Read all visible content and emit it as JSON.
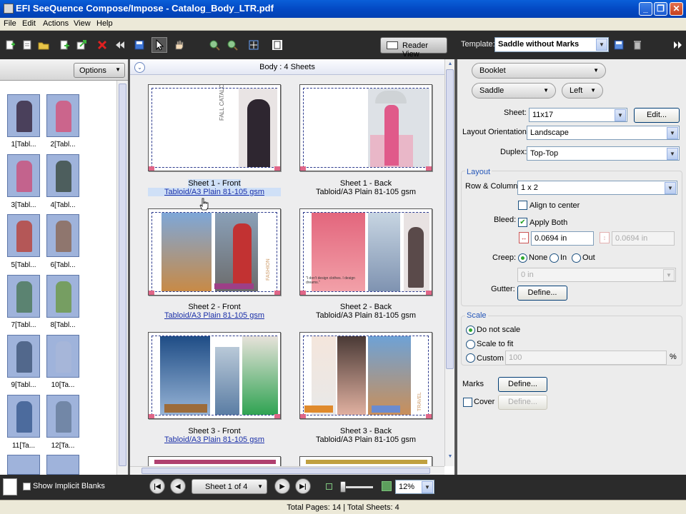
{
  "window": {
    "title": "EFI SeeQuence Compose/Impose - Catalog_Body_LTR.pdf",
    "minimize": "_",
    "maximize": "❐",
    "close": "✕"
  },
  "menu": [
    "File",
    "Edit",
    "Actions",
    "View",
    "Help"
  ],
  "toolbar": {
    "icons": [
      "new-icon",
      "open-icon",
      "folder-icon",
      "add-page-icon",
      "export-icon",
      "delete-icon",
      "rewind-icon",
      "save-icon",
      "pointer-icon",
      "hand-icon",
      "zoom-in-icon",
      "zoom-out-icon",
      "fit-icon",
      "document-icon"
    ],
    "reader_view": "Reader View",
    "template_label": "Template:",
    "template_value": "Saddle without Marks"
  },
  "left_panel": {
    "options_label": "Options",
    "thumbnails": [
      "1[Tabl...",
      "2[Tabl...",
      "3[Tabl...",
      "4[Tabl...",
      "5[Tabl...",
      "6[Tabl...",
      "7[Tabl...",
      "8[Tabl...",
      "9[Tabl...",
      "10[Ta...",
      "11[Ta...",
      "12[Ta..."
    ]
  },
  "center": {
    "header": "Body : 4 Sheets",
    "collapse_glyph": "⌄",
    "sheets": [
      {
        "line1": "Sheet 1 - Front",
        "line2": "Tabloid/A3 Plain 81-105 gsm",
        "vert_text": "FALL CATALOG"
      },
      {
        "line1": "Sheet 1 - Back",
        "line2": "Tabloid/A3 Plain 81-105 gsm"
      },
      {
        "line1": "Sheet 2 - Front",
        "line2": "Tabloid/A3 Plain 81-105 gsm",
        "vert_text": "FASHION"
      },
      {
        "line1": "Sheet 2 - Back",
        "line2": "Tabloid/A3 Plain 81-105 gsm",
        "caption": "\"I don't design clothes. I design dreams.\""
      },
      {
        "line1": "Sheet 3 - Front",
        "line2": "Tabloid/A3 Plain 81-105 gsm"
      },
      {
        "line1": "Sheet 3 - Back",
        "line2": "Tabloid/A3 Plain 81-105 gsm",
        "vert_text": "TRAVEL"
      }
    ]
  },
  "right_panel": {
    "booklet": "Booklet",
    "saddle": "Saddle",
    "left": "Left",
    "sheet_label": "Sheet:",
    "sheet_value": "11x17",
    "edit_btn": "Edit...",
    "orientation_label": "Layout Orientation:",
    "orientation_value": "Landscape",
    "duplex_label": "Duplex:",
    "duplex_value": "Top-Top",
    "layout_title": "Layout",
    "row_col_label": "Row & Column:",
    "row_col_value": "1 x 2",
    "align_center": "Align to center",
    "bleed_label": "Bleed:",
    "apply_both": "Apply Both",
    "bleed_h": "0.0694 in",
    "bleed_v": "0.0694 in",
    "creep_label": "Creep:",
    "creep_none": "None",
    "creep_in": "In",
    "creep_out": "Out",
    "creep_value": "0 in",
    "gutter_label": "Gutter:",
    "gutter_btn": "Define...",
    "scale_title": "Scale",
    "scale_none": "Do not scale",
    "scale_fit": "Scale to fit",
    "scale_custom": "Custom",
    "custom_value": "100",
    "percent": "%",
    "marks_label": "Marks",
    "marks_btn": "Define...",
    "cover_label": "Cover",
    "cover_btn": "Define..."
  },
  "bottom": {
    "show_blanks": "Show Implicit Blanks",
    "sheet_nav": "Sheet 1 of 4",
    "zoom": "12%",
    "nav_first": "|◀",
    "nav_prev": "◀",
    "nav_next": "▶",
    "nav_last": "▶|"
  },
  "status": "Total Pages: 14 | Total Sheets: 4",
  "colors": {
    "title_bar": "#0349c4",
    "toolbar": "#2b2b2b",
    "accent_link": "#1a2fa8",
    "group_title": "#2355b8",
    "bleed_marker": "#e06688"
  }
}
